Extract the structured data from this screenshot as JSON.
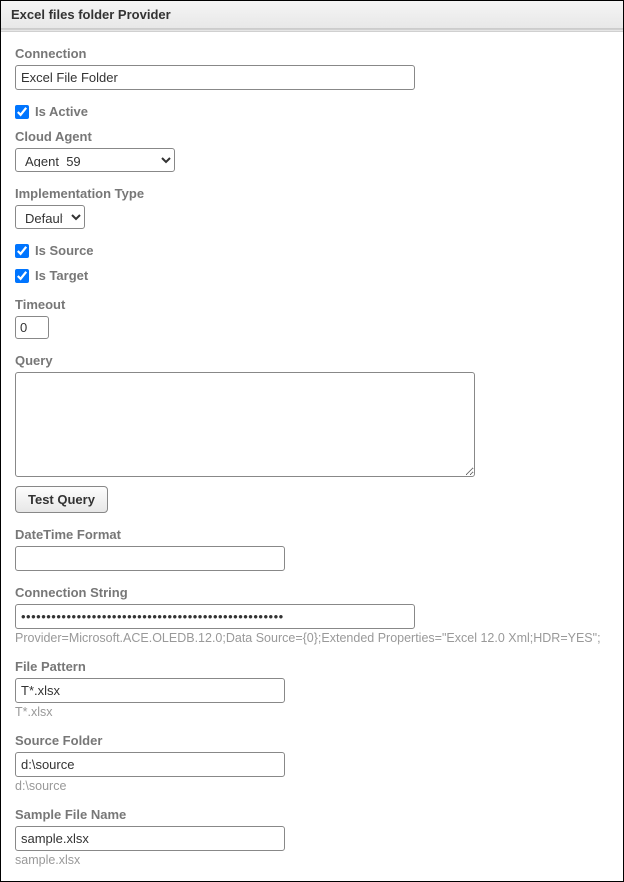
{
  "window": {
    "title": "Excel files folder Provider"
  },
  "labels": {
    "connection": "Connection",
    "is_active": "Is Active",
    "cloud_agent": "Cloud Agent",
    "implementation_type": "Implementation Type",
    "is_source": "Is Source",
    "is_target": "Is Target",
    "timeout": "Timeout",
    "query": "Query",
    "test_query": "Test Query",
    "datetime_format": "DateTime Format",
    "connection_string": "Connection String",
    "file_pattern": "File Pattern",
    "source_folder": "Source Folder",
    "sample_file_name": "Sample File Name"
  },
  "values": {
    "connection": "Excel File Folder",
    "is_active": true,
    "cloud_agent_selected": "Agent_59",
    "implementation_type_selected": "Default",
    "is_source": true,
    "is_target": true,
    "timeout": "0",
    "query": "",
    "datetime_format": "",
    "connection_string_mask": "••••••••••••••••••••••••••••••••••••••••••••••••••••",
    "connection_string_hint": "Provider=Microsoft.ACE.OLEDB.12.0;Data Source={0};Extended Properties=\"Excel 12.0 Xml;HDR=YES\";",
    "file_pattern": "T*.xlsx",
    "file_pattern_hint": "T*.xlsx",
    "source_folder": "d:\\source",
    "source_folder_hint": "d:\\source",
    "sample_file_name": "sample.xlsx",
    "sample_file_name_hint": "sample.xlsx"
  },
  "options": {
    "cloud_agent": [
      "Agent_59"
    ],
    "implementation_type": [
      "Default"
    ]
  }
}
